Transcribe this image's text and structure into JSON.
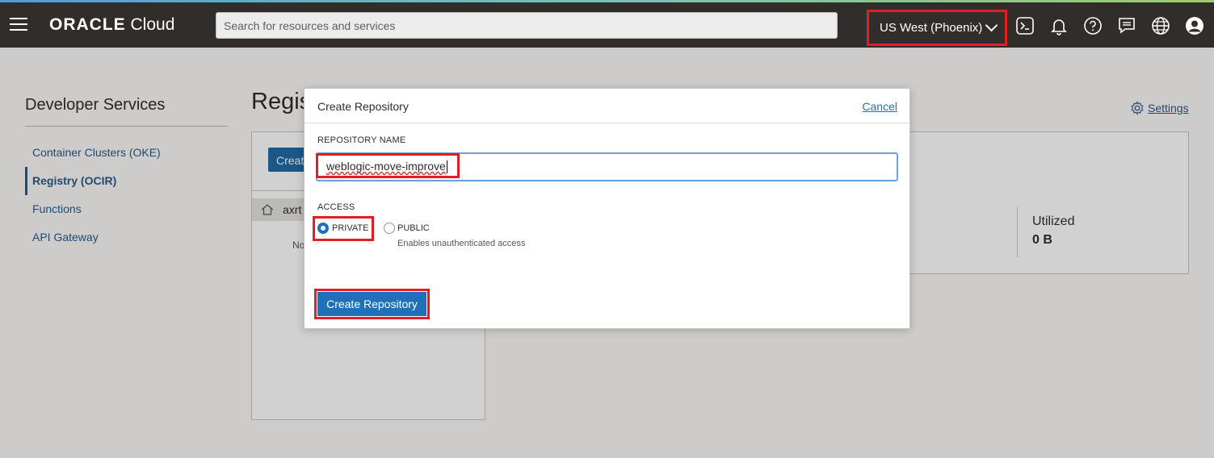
{
  "header": {
    "brand_bold": "ORACLE",
    "brand_light": "Cloud",
    "search_placeholder": "Search for resources and services",
    "region": "US West (Phoenix)",
    "icons": [
      "menu-icon",
      "cloud-shell-icon",
      "bell-icon",
      "help-icon",
      "chat-icon",
      "globe-icon",
      "user-icon"
    ]
  },
  "sidebar": {
    "title": "Developer Services",
    "items": [
      {
        "label": "Container Clusters (OKE)",
        "active": false
      },
      {
        "label": "Registry (OCIR)",
        "active": true
      },
      {
        "label": "Functions",
        "active": false
      },
      {
        "label": "API Gateway",
        "active": false
      }
    ]
  },
  "page": {
    "title": "Regis",
    "create_label": "Create",
    "repo_row": "axrt",
    "no_text": "No",
    "settings_label": "Settings",
    "utilized_label": "Utilized",
    "utilized_value": "0 B"
  },
  "modal": {
    "title": "Create Repository",
    "cancel": "Cancel",
    "name_label": "REPOSITORY NAME",
    "name_value": "weblogic-move-improve",
    "access_label": "ACCESS",
    "private_label": "PRIVATE",
    "public_label": "PUBLIC",
    "public_hint": "Enables unauthenticated access",
    "selected_access": "PRIVATE",
    "submit": "Create Repository"
  },
  "colors": {
    "header_bg": "#312d2a",
    "highlight": "#e21d24",
    "primary": "#1f6fb9",
    "link": "#2a6fb0"
  }
}
